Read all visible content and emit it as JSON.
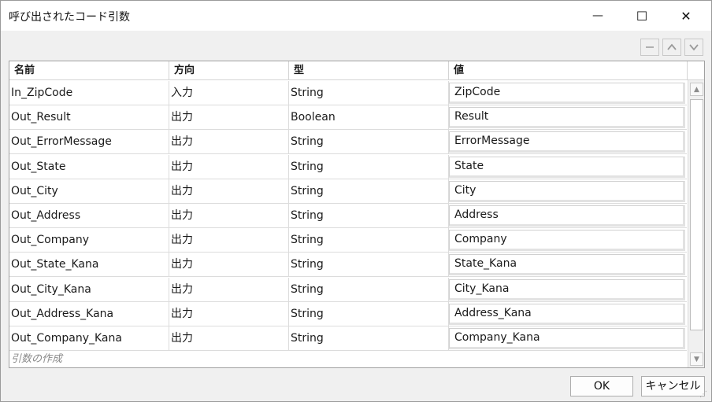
{
  "window": {
    "title": "呼び出されたコード引数",
    "minimize_glyph": "—",
    "maximize_glyph": "☐",
    "close_glyph": "✕"
  },
  "toolbar": {
    "remove_icon": "minus-icon",
    "up_icon": "chevron-up-icon",
    "down_icon": "chevron-down-icon"
  },
  "grid": {
    "headers": [
      "名前",
      "方向",
      "型",
      "値"
    ],
    "rows": [
      {
        "name": "In_ZipCode",
        "direction": "入力",
        "type": "String",
        "value": "ZipCode"
      },
      {
        "name": "Out_Result",
        "direction": "出力",
        "type": "Boolean",
        "value": "Result"
      },
      {
        "name": "Out_ErrorMessage",
        "direction": "出力",
        "type": "String",
        "value": "ErrorMessage"
      },
      {
        "name": "Out_State",
        "direction": "出力",
        "type": "String",
        "value": "State"
      },
      {
        "name": "Out_City",
        "direction": "出力",
        "type": "String",
        "value": "City"
      },
      {
        "name": "Out_Address",
        "direction": "出力",
        "type": "String",
        "value": "Address"
      },
      {
        "name": "Out_Company",
        "direction": "出力",
        "type": "String",
        "value": "Company"
      },
      {
        "name": "Out_State_Kana",
        "direction": "出力",
        "type": "String",
        "value": "State_Kana"
      },
      {
        "name": "Out_City_Kana",
        "direction": "出力",
        "type": "String",
        "value": "City_Kana"
      },
      {
        "name": "Out_Address_Kana",
        "direction": "出力",
        "type": "String",
        "value": "Address_Kana"
      },
      {
        "name": "Out_Company_Kana",
        "direction": "出力",
        "type": "String",
        "value": "Company_Kana"
      }
    ],
    "create_argument_label": "引数の作成"
  },
  "buttons": {
    "ok_label": "OK",
    "cancel_label": "キャンセル"
  }
}
